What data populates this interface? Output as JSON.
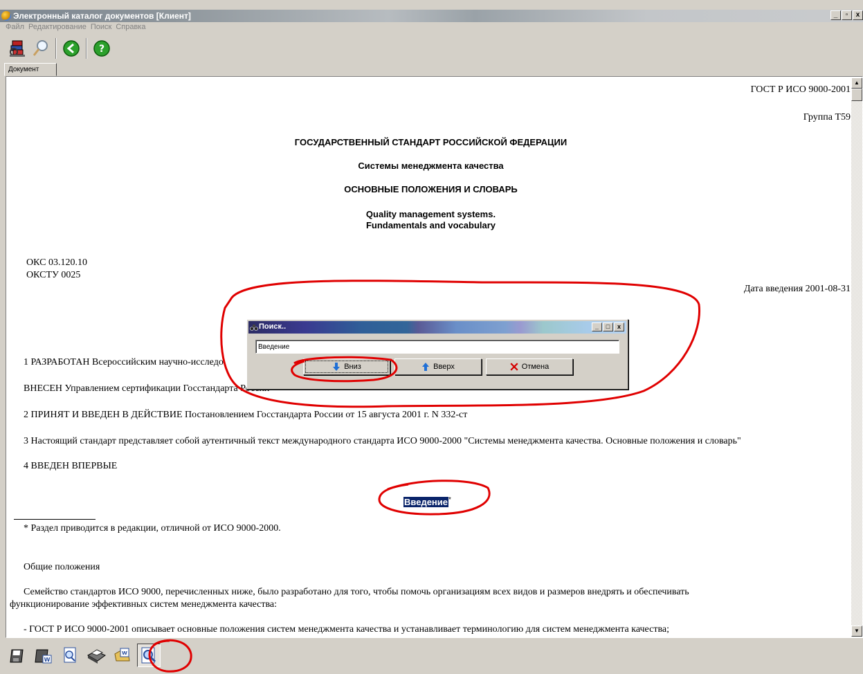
{
  "window": {
    "title": "Электронный каталог документов [Клиент]",
    "min": "_",
    "max": "▫",
    "close": "x"
  },
  "menu": [
    "Файл",
    "Редактирование",
    "Поиск",
    "Справка"
  ],
  "tab": "Документ",
  "document": {
    "code": "ГОСТ Р ИСО 9000-2001",
    "group": "Группа Т59",
    "heading1": "ГОСУДАРСТВЕННЫЙ СТАНДАРТ РОССИЙСКОЙ ФЕДЕРАЦИИ",
    "heading2": "Системы менеджмента качества",
    "heading3": "ОСНОВНЫЕ ПОЛОЖЕНИЯ И СЛОВАРЬ",
    "english1": "Quality management systems.",
    "english2": "Fundamentals and vocabulary",
    "oks": "ОКС 03.120.10",
    "okstu": "ОКСТУ 0025",
    "date": "Дата введения 2001-08-31",
    "p1": "1 РАЗРАБОТАН Всероссийским научно-исследо",
    "p2": "ВНЕСЕН Управлением сертификации Госстандарта России",
    "p3": "2 ПРИНЯТ И ВВЕДЕН В ДЕЙСТВИЕ Постановлением Госстандарта России от 15 августа 2001 г. N 332-ст",
    "p4": "3 Настоящий стандарт представляет собой аутентичный текст международного стандарта ИСО 9000-2000 \"Системы менеджмента качества. Основные положения и словарь\"",
    "p5": "4 ВВЕДЕН ВПЕРВЫЕ",
    "intro": "Введение",
    "intro_mark": "*",
    "footnote": "* Раздел приводится в редакции, отличной от ИСО 9000-2000.",
    "general": "Общие положения",
    "para1a": "Семейство стандартов ИСО 9000, перечисленных ниже, было разработано для того, чтобы помочь организациям всех видов и размеров внедрять и обеспечивать",
    "para1b": "функционирование эффективных систем менеджмента качества:",
    "bullet1": "- ГОСТ Р ИСО 9000-2001 описывает основные положения систем менеджмента качества и устанавливает терминологию для систем менеджмента качества;"
  },
  "dialog": {
    "title": "Поиск..",
    "input_value": "Введение",
    "btn_down": "Вниз",
    "btn_up": "Вверх",
    "btn_cancel": "Отмена"
  },
  "colors": {
    "highlight": "#0a246a",
    "annotation": "#e00000",
    "arrow_blue": "#1f6fd6",
    "cancel_red": "#d40000"
  },
  "icons": {
    "toolbar": [
      "books-icon",
      "search-icon",
      "back-icon",
      "help-icon"
    ],
    "bottom": [
      "save-icon",
      "save-word-icon",
      "preview-icon",
      "print-icon",
      "word-icon",
      "find-icon"
    ]
  }
}
